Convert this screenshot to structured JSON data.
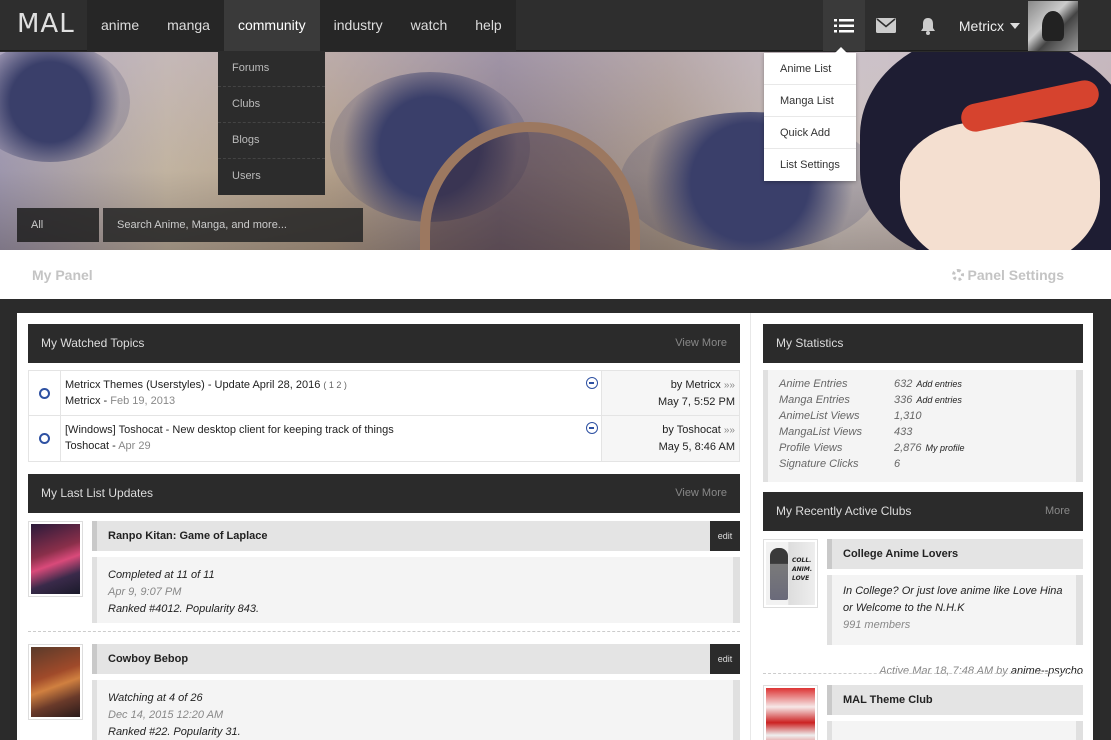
{
  "header": {
    "logo": "MAL",
    "nav": [
      "anime",
      "manga",
      "community",
      "industry",
      "watch",
      "help"
    ],
    "user": "Metricx"
  },
  "community_menu": [
    "Forums",
    "Clubs",
    "Blogs",
    "Users"
  ],
  "list_menu": [
    "Anime List",
    "Manga List",
    "Quick Add",
    "List Settings"
  ],
  "search": {
    "category": "All",
    "placeholder": "Search Anime, Manga, and more..."
  },
  "panel": {
    "title": "My Panel",
    "settings": "Panel Settings"
  },
  "watched_topics": {
    "title": "My Watched Topics",
    "more": "View More",
    "items": [
      {
        "title": "Metricx Themes (Userstyles) - Update April 28, 2016",
        "pages": "( 1 2 )",
        "author": "Metricx",
        "date": "Feb 19, 2013",
        "last_by": "by Metricx",
        "last_date": "May 7, 5:52 PM"
      },
      {
        "title": "[Windows] Toshocat - New desktop client for keeping track of things",
        "pages": "",
        "author": "Toshocat",
        "date": "Apr 29",
        "last_by": "by Toshocat",
        "last_date": "May 5, 8:46 AM"
      }
    ]
  },
  "list_updates": {
    "title": "My Last List Updates",
    "more": "View More",
    "edit_label": "edit",
    "items": [
      {
        "title": "Ranpo Kitan: Game of Laplace",
        "status": "Completed at 11 of 11",
        "date": "Apr 9, 9:07 PM",
        "rank": "Ranked #4012. Popularity 843."
      },
      {
        "title": "Cowboy Bebop",
        "status": "Watching at 4 of 26",
        "date": "Dec 14, 2015 12:20 AM",
        "rank": "Ranked #22. Popularity 31."
      }
    ]
  },
  "statistics": {
    "title": "My Statistics",
    "rows": [
      {
        "label": "Anime Entries",
        "value": "632",
        "link": "Add entries"
      },
      {
        "label": "Manga Entries",
        "value": "336",
        "link": "Add entries"
      },
      {
        "label": "AnimeList Views",
        "value": "1,310",
        "link": ""
      },
      {
        "label": "MangaList Views",
        "value": "433",
        "link": ""
      },
      {
        "label": "Profile Views",
        "value": "2,876",
        "link": "My profile"
      },
      {
        "label": "Signature Clicks",
        "value": "6",
        "link": ""
      }
    ]
  },
  "clubs": {
    "title": "My Recently Active Clubs",
    "more": "More",
    "items": [
      {
        "name": "College Anime Lovers",
        "desc1": "In College? Or just love anime like Love Hina",
        "desc2": "or Welcome to the N.H.K",
        "members": "991 members",
        "active": "Active Mar 18, 7:48 AM by",
        "active_by": "anime--psycho",
        "thumb_text": "COLL. ANIM. LOVE"
      },
      {
        "name": "MAL Theme Club"
      }
    ]
  },
  "colors": {
    "accent": "#2e51a2",
    "dark": "#2b2b2b"
  }
}
